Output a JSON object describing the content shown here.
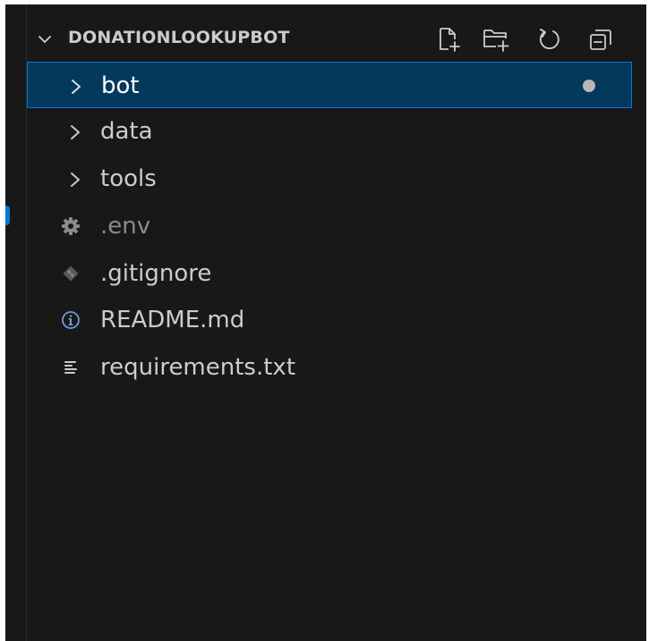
{
  "explorer": {
    "section_title": "DONATIONLOOKUPBOT",
    "actions": [
      {
        "name": "new-file",
        "icon": "new-file-icon"
      },
      {
        "name": "new-folder",
        "icon": "new-folder-icon"
      },
      {
        "name": "refresh",
        "icon": "refresh-icon"
      },
      {
        "name": "collapse-all",
        "icon": "collapse-all-icon"
      }
    ],
    "items": [
      {
        "label": "bot",
        "kind": "folder",
        "expanded": false,
        "selected": true,
        "modified": true
      },
      {
        "label": "data",
        "kind": "folder",
        "expanded": false
      },
      {
        "label": "tools",
        "kind": "folder",
        "expanded": false
      },
      {
        "label": ".env",
        "kind": "file",
        "icon": "gear-icon",
        "ignored": true
      },
      {
        "label": ".gitignore",
        "kind": "file",
        "icon": "git-icon"
      },
      {
        "label": "README.md",
        "kind": "file",
        "icon": "info-icon"
      },
      {
        "label": "requirements.txt",
        "kind": "file",
        "icon": "text-lines-icon"
      }
    ]
  },
  "colors": {
    "background": "#181818",
    "selection_bg": "#04395e",
    "selection_border": "#0078d4",
    "text": "#cccccc",
    "dim_text": "#8b8b8b",
    "modified_dot": "#b8b8b8",
    "accent_marker": "#0078d4"
  }
}
